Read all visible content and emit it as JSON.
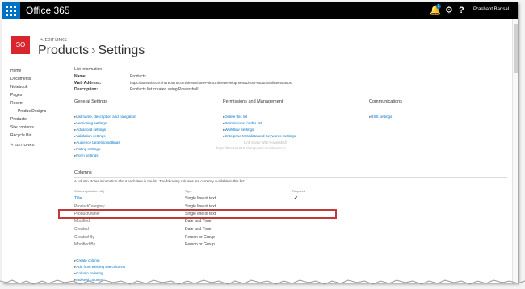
{
  "topbar": {
    "brand": "Office 365",
    "notification_count": "1",
    "user_name": "Prashant Bansal"
  },
  "site": {
    "logo_text": "SO",
    "edit_links": "EDIT LINKS",
    "title_list": "Products",
    "title_page": "Settings"
  },
  "nav": {
    "items": [
      "Home",
      "Documents",
      "Notebook",
      "Pages",
      "Recent",
      "ProductDesigns",
      "Products",
      "Site contents",
      "Recycle Bin"
    ],
    "edit_links": "EDIT LINKS"
  },
  "list_info": {
    "heading": "List Information",
    "name_label": "Name:",
    "name_value": "Products",
    "web_label": "Web Address:",
    "web_value": "https://bansal1619.sharepoint.com/sites/SharePointOnlineDevelopment/Lists/Products/AllItems.aspx",
    "desc_label": "Description:",
    "desc_value": "Products list created using Powershell"
  },
  "general_settings": {
    "heading": "General Settings",
    "links": [
      "List name, description and navigation",
      "Versioning settings",
      "Advanced settings",
      "Validation settings",
      "Audience targeting settings",
      "Rating settings",
      "Form settings"
    ]
  },
  "permissions": {
    "heading": "Permissions and Management",
    "links": [
      "Delete this list",
      "Permissions for this list",
      "Workflow Settings",
      "Enterprise Metadata and Keywords Settings"
    ],
    "gray_1": "Link Share With Powershell",
    "gray_2": "https://bansal1619.sharepoint.com/sites/xxxx"
  },
  "communications": {
    "heading": "Communications",
    "links": [
      "RSS settings"
    ]
  },
  "columns": {
    "heading": "Columns",
    "description": "A column stores information about each item in the list. The following columns are currently available in this list:",
    "header": {
      "name": "Column (click to edit)",
      "type": "Type",
      "required": "Required"
    },
    "rows": [
      {
        "name": "Title",
        "type": "Single line of text",
        "required": "✔"
      },
      {
        "name": "ProductCategory",
        "type": "Single line of text",
        "required": ""
      },
      {
        "name": "ProductOwner",
        "type": "Single line of text",
        "required": ""
      },
      {
        "name": "Modified",
        "type": "Date and Time",
        "required": ""
      },
      {
        "name": "Created",
        "type": "Date and Time",
        "required": ""
      },
      {
        "name": "Created By",
        "type": "Person or Group",
        "required": ""
      },
      {
        "name": "Modified By",
        "type": "Person or Group",
        "required": ""
      }
    ],
    "actions": [
      "Create column",
      "Add from existing site columns",
      "Column ordering",
      "Indexed columns"
    ]
  }
}
